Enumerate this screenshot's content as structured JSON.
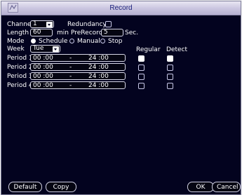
{
  "window": {
    "title": "Record"
  },
  "channel": {
    "label": "Channel",
    "value": "1"
  },
  "redundancy": {
    "label": "Redundancy",
    "checked": false
  },
  "length": {
    "label": "Length",
    "value": "60",
    "unit": "min"
  },
  "prerecord": {
    "label": "PreRecord",
    "value": "5",
    "unit": "Sec."
  },
  "mode": {
    "label": "Mode",
    "options": [
      {
        "label": "Schedule",
        "selected": true
      },
      {
        "label": "Manual",
        "selected": false
      },
      {
        "label": "Stop",
        "selected": false
      }
    ]
  },
  "week": {
    "label": "Week",
    "value": "Tue"
  },
  "columns": {
    "regular": "Regular",
    "detect": "Detect"
  },
  "periods": [
    {
      "label": "Period 1",
      "start": "00 :00",
      "sep": "-",
      "end": "24 :00",
      "regular": true,
      "detect": true
    },
    {
      "label": "Period 2",
      "start": "00 :00",
      "sep": "-",
      "end": "24 :00",
      "regular": false,
      "detect": false
    },
    {
      "label": "Period 3",
      "start": "00 :00",
      "sep": "-",
      "end": "24 :00",
      "regular": false,
      "detect": false
    },
    {
      "label": "Period 4",
      "start": "00 :00",
      "sep": "-",
      "end": "24 :00",
      "regular": false,
      "detect": false
    }
  ],
  "buttons": {
    "default": "Default",
    "copy": "Copy",
    "ok": "OK",
    "cancel": "Cancel"
  }
}
